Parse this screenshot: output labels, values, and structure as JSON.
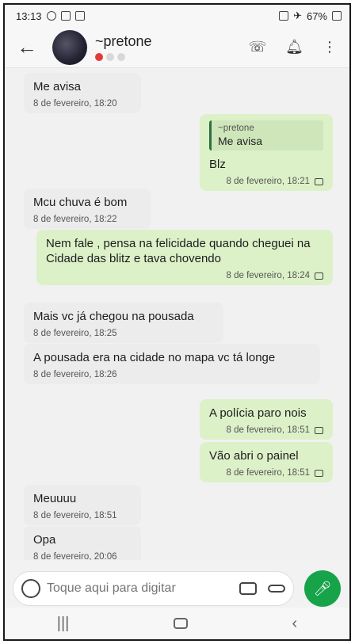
{
  "status_bar": {
    "time": "13:13",
    "battery": "67%",
    "icons": [
      "wifi-icon",
      "image-icon",
      "calendar-icon",
      "signal-icon",
      "airplane-icon",
      "battery-icon"
    ]
  },
  "header": {
    "contact_name": "~pretone",
    "icons": {
      "back": "arrow-left",
      "call": "phone-lock-icon",
      "alert": "bell-icon",
      "menu": "more-vert-icon"
    }
  },
  "messages": [
    {
      "dir": "in",
      "text": "Me avisa",
      "time": "8 de fevereiro, 18:20"
    },
    {
      "dir": "out",
      "reply_to_author": "~pretone",
      "reply_to_text": "Me avisa",
      "text": "Blz",
      "time": "8 de fevereiro, 18:21"
    },
    {
      "dir": "in",
      "text": "Mcu chuva é bom",
      "time": "8 de fevereiro, 18:22"
    },
    {
      "dir": "out",
      "text": "Nem fale , pensa na felicidade  quando cheguei na Cidade das blitz e tava chovendo",
      "time": "8 de fevereiro, 18:24"
    },
    {
      "dir": "in",
      "text": "Mais vc já chegou na pousada",
      "time": "8 de fevereiro, 18:25"
    },
    {
      "dir": "in",
      "text": "A pousada era na cidade no mapa vc tá longe",
      "time": "8 de fevereiro, 18:26"
    },
    {
      "dir": "out",
      "text": "A polícia paro nois",
      "time": "8 de fevereiro, 18:51"
    },
    {
      "dir": "out",
      "text": "Vão abri o painel",
      "time": "8 de fevereiro, 18:51"
    },
    {
      "dir": "in",
      "text": "Meuuuu",
      "time": "8 de fevereiro, 18:51"
    },
    {
      "dir": "in",
      "text": "Opa",
      "time": "8 de fevereiro, 20:06"
    }
  ],
  "composer": {
    "placeholder": "Toque aqui para digitar"
  },
  "colors": {
    "outgoing_bubble": "#dcf1c8",
    "incoming_bubble": "#ececec",
    "mic_button": "#16a34a",
    "presence_active": "#e23b3b"
  }
}
